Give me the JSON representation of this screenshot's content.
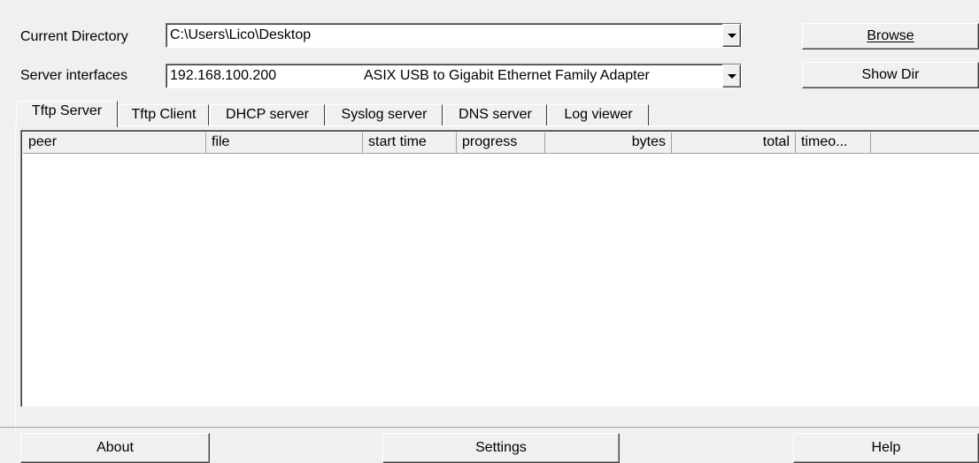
{
  "current_directory": {
    "label": "Current Directory",
    "value": "C:\\Users\\Lico\\Desktop"
  },
  "server_interfaces": {
    "label": "Server interfaces",
    "ip": "192.168.100.200",
    "adapter": "ASIX USB to Gigabit Ethernet Family Adapter"
  },
  "buttons": {
    "browse": "Browse",
    "show_dir": "Show Dir",
    "about": "About",
    "settings": "Settings",
    "help": "Help"
  },
  "tabs": [
    {
      "label": "Tftp Server",
      "active": true
    },
    {
      "label": "Tftp Client"
    },
    {
      "label": "DHCP server"
    },
    {
      "label": "Syslog server"
    },
    {
      "label": "DNS server"
    },
    {
      "label": "Log viewer"
    }
  ],
  "columns": [
    "peer",
    "file",
    "start time",
    "progress",
    "bytes",
    "total",
    "timeo..."
  ],
  "rows": [],
  "icons": {
    "dropdown": "chevron-down-icon"
  },
  "colors": {
    "face": "#f0f0f0",
    "window": "#ffffff",
    "shadow": "#a0a0a0"
  }
}
